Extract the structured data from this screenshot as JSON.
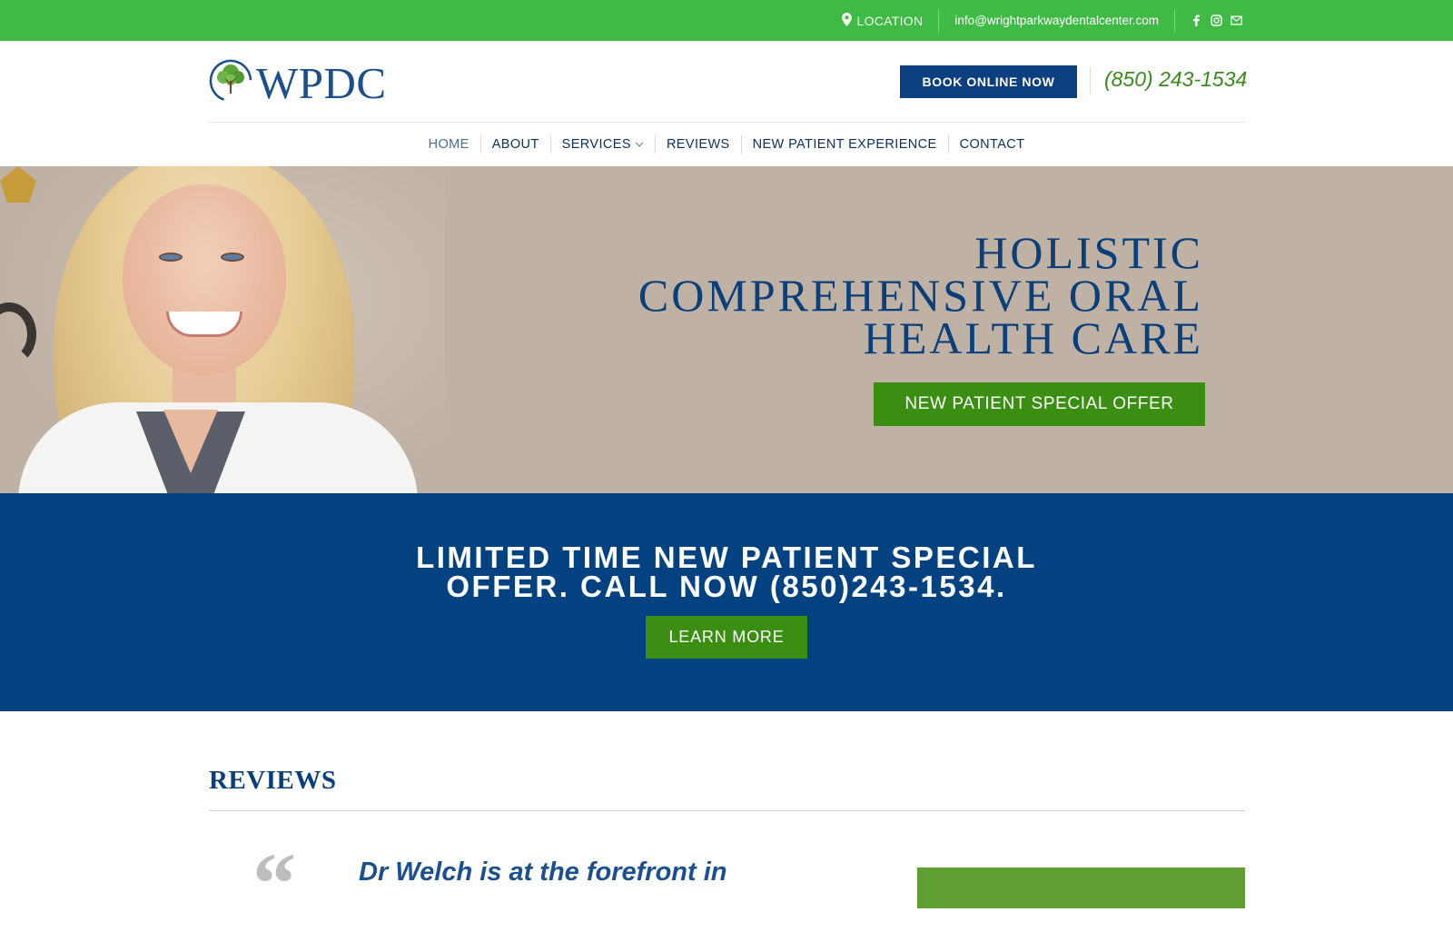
{
  "topbar": {
    "location_label": "LOCATION",
    "email": "info@wrightparkwaydentalcenter.com",
    "social_icons": [
      "facebook-icon",
      "instagram-icon",
      "mail-icon"
    ]
  },
  "header": {
    "logo_text": "WPDC",
    "book_button": "BOOK ONLINE NOW",
    "phone": "(850) 243-1534"
  },
  "nav": {
    "items": [
      {
        "label": "HOME"
      },
      {
        "label": "ABOUT"
      },
      {
        "label": "SERVICES"
      },
      {
        "label": "REVIEWS"
      },
      {
        "label": "NEW PATIENT EXPERIENCE"
      },
      {
        "label": "CONTACT"
      }
    ]
  },
  "hero": {
    "title_line1": "HOLISTIC",
    "title_line2": "COMPREHENSIVE ORAL",
    "title_line3": "HEALTH CARE",
    "button": "NEW PATIENT SPECIAL OFFER"
  },
  "offer": {
    "line1": "LIMITED TIME NEW PATIENT SPECIAL",
    "line2": "OFFER. CALL NOW (850)243-1534.",
    "button": "LEARN MORE"
  },
  "reviews": {
    "title": "REVIEWS",
    "quote_mark": "“",
    "first_review_text": "Dr Welch is at the forefront in"
  },
  "colors": {
    "top_green": "#3fbb45",
    "navy": "#034281",
    "button_green": "#3a8f12",
    "hero_bg": "#bfb1a3"
  }
}
